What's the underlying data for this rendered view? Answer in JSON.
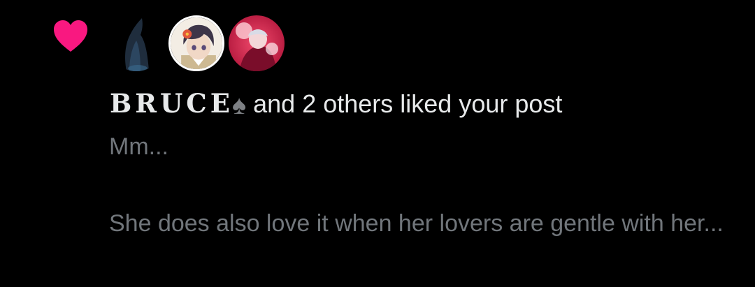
{
  "notification": {
    "type_icon": "heart-icon",
    "accent_color": "#f91880",
    "avatars": [
      {
        "name": "avatar-hooded-figure"
      },
      {
        "name": "avatar-anime-boy"
      },
      {
        "name": "avatar-anime-red"
      }
    ],
    "headline": {
      "username": "BRUCE",
      "badge_icon": "spade-icon",
      "badge_glyph": "♠",
      "action": "and 2 others liked your post"
    },
    "post": {
      "line1": "Mm...",
      "line2": "She does also love it when her lovers are gentle with her..."
    }
  }
}
